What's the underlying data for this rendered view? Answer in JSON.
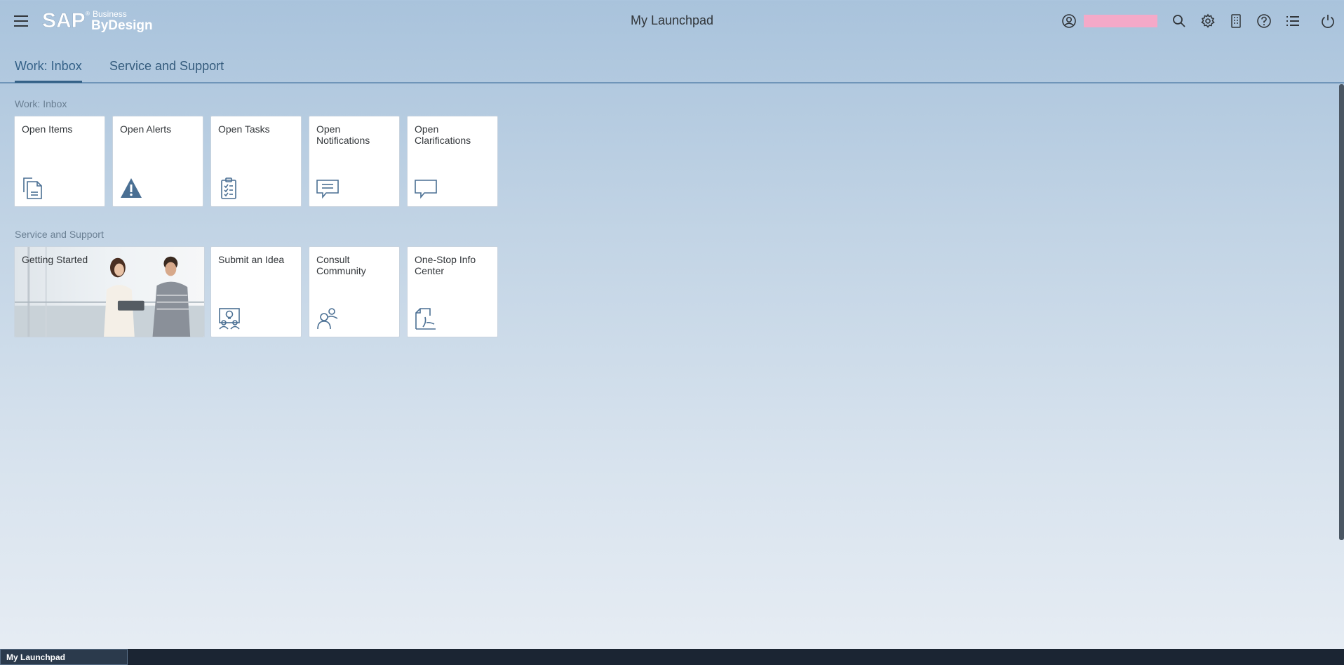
{
  "header": {
    "menu_icon": "hamburger-menu-icon",
    "logo": {
      "brand": "SAP",
      "registered": "®",
      "line1": "Business",
      "line2": "ByDesign"
    },
    "title": "My Launchpad",
    "user_name": "",
    "icons": [
      "user-icon",
      "search-icon",
      "settings-icon",
      "notes-icon",
      "help-icon",
      "list-icon",
      "power-icon"
    ]
  },
  "tabs": [
    {
      "label": "Work: Inbox",
      "active": true
    },
    {
      "label": "Service and Support",
      "active": false
    }
  ],
  "sections": [
    {
      "title": "Work: Inbox",
      "tiles": [
        {
          "label": "Open Items",
          "icon": "documents-icon"
        },
        {
          "label": "Open Alerts",
          "icon": "alert-icon"
        },
        {
          "label": "Open Tasks",
          "icon": "task-clipboard-icon"
        },
        {
          "label": "Open Notifications",
          "icon": "notification-message-icon"
        },
        {
          "label": "Open Clarifications",
          "icon": "speech-bubble-icon"
        }
      ]
    },
    {
      "title": "Service and Support",
      "tiles": [
        {
          "label": "Getting Started",
          "icon": "photo-people"
        },
        {
          "label": "Submit an Idea",
          "icon": "idea-presentation-icon"
        },
        {
          "label": "Consult Community",
          "icon": "community-icon"
        },
        {
          "label": "One-Stop Info Center",
          "icon": "pdf-document-icon"
        }
      ]
    }
  ],
  "taskbar": {
    "active_item": "My Launchpad"
  },
  "colors": {
    "accent": "#346187",
    "icon": "#4a6f93",
    "user_block": "#f4a9c8"
  }
}
